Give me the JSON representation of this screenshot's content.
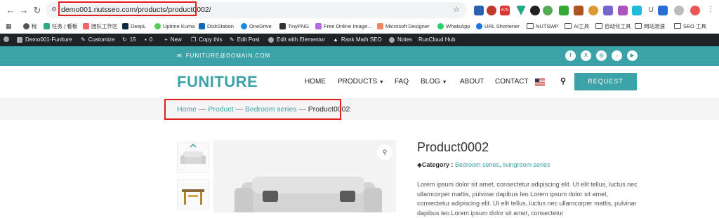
{
  "browser": {
    "url": "demo001.nutsseo.com/products/product0002/",
    "bookmarks": [
      "稅",
      "任务 | 看板",
      "团队工作区",
      "DeepL",
      "Uptime Kuma",
      "DiskStation",
      "OneDrive",
      "TinyPNG",
      "Free Online Image...",
      "Microsoft Designer",
      "WhatsApp",
      "URL Shortener",
      "NUTSWP",
      "AI工具",
      "自动化工具",
      "网站测速",
      "SEO 工具"
    ],
    "ext_badge": "679",
    "ext_u": "U"
  },
  "adminbar": {
    "site": "Demo001-Funiture",
    "customize": "Customize",
    "updates": "15",
    "comments": "0",
    "new": "New",
    "copy": "Copy this",
    "edit_post": "Edit Post",
    "elementor": "Edit with Elementor",
    "rankmath": "Rank Math SEO",
    "notes": "Notes",
    "runcloud": "RunCloud Hub"
  },
  "topbar": {
    "email": "FUNITURE@DOMAIN.COM",
    "social": [
      "f",
      "X",
      "◎",
      "♪",
      "▶"
    ]
  },
  "header": {
    "logo": "FUNITURE",
    "menu": [
      "HOME",
      "PRODUCTS",
      "FAQ",
      "BLOG",
      "ABOUT",
      "CONTACT"
    ],
    "request": "REQUEST"
  },
  "breadcrumb": {
    "items": [
      "Home",
      "Product",
      "Bedroom series"
    ],
    "sep": " — ",
    "current": "Product0002"
  },
  "product": {
    "title": "Product0002",
    "category_label": "Category :",
    "categories": [
      "Bedroom series",
      "livingroom series"
    ],
    "description": "Lorem ipsum dolor sit amet, consectetur adipiscing elit. Ut elit tellus, luctus nec ullamcorper mattis, pulvinar dapibus leo.Lorem ipsum dolor sit amet, consectetur adipiscing elit. Ut elit tellus, luctus nec ullamcorper mattis, pulvinar dapibus leo.Lorem ipsum dolor sit amet, consectetur"
  },
  "colors": {
    "accent": "#3ba3a7",
    "highlight": "#e0201c",
    "adminbar": "#1d2327"
  }
}
